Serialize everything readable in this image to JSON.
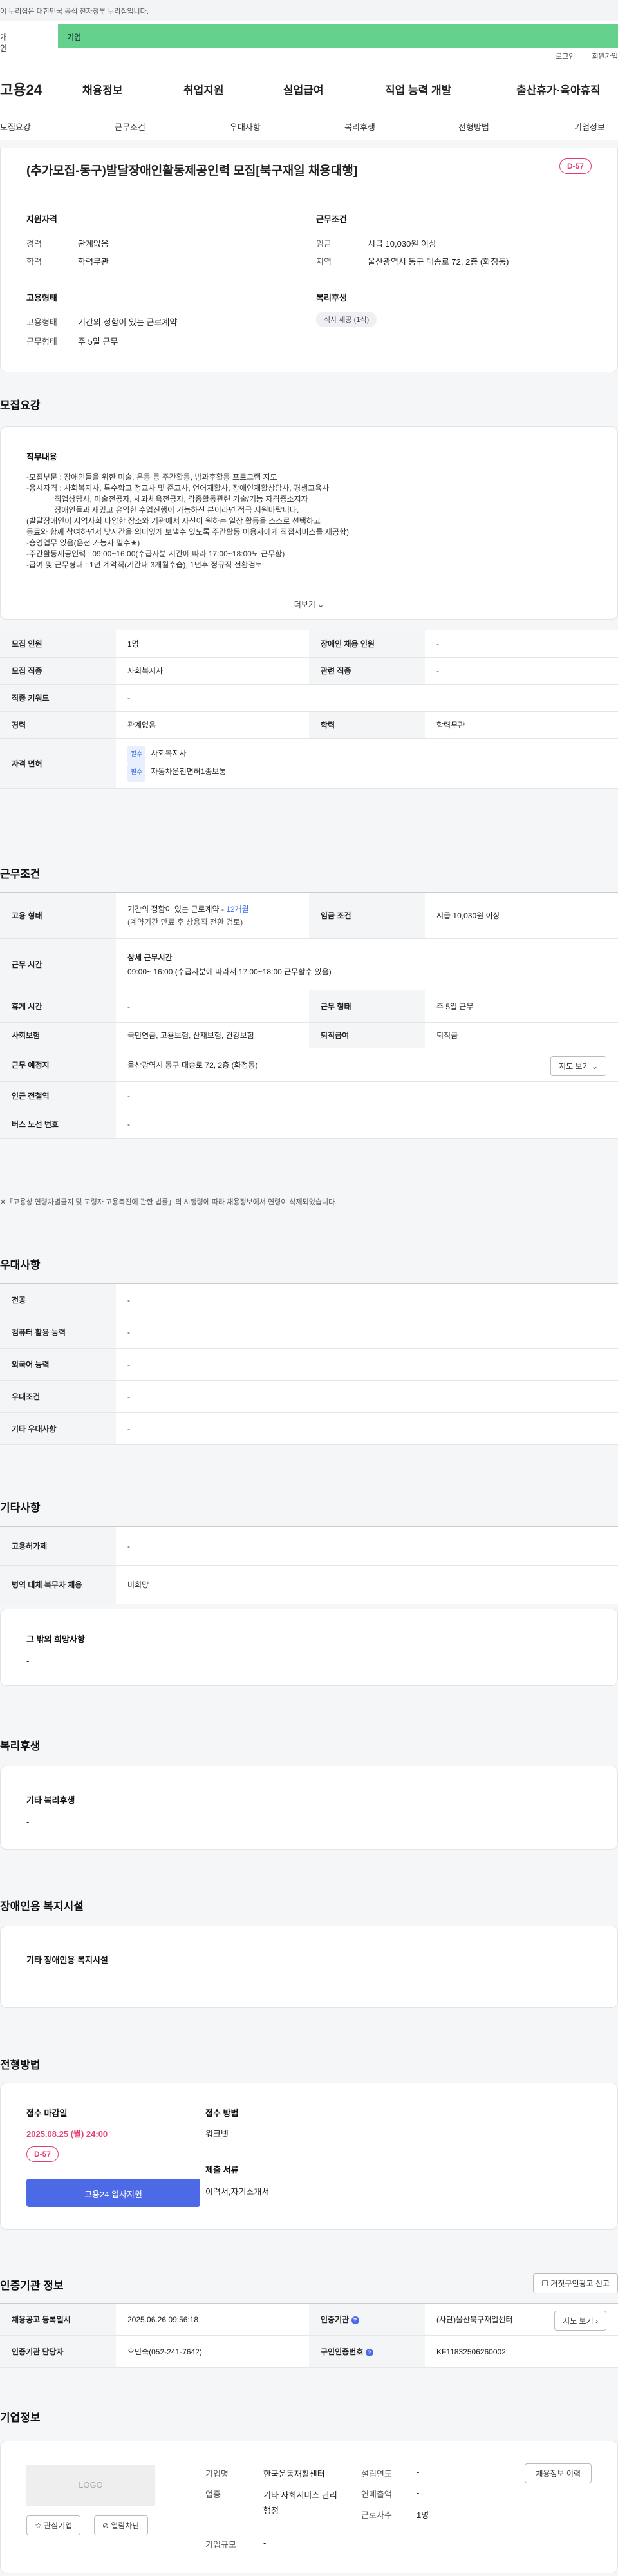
{
  "gov_banner": "이 누리집은 대한민국 공식 전자정부 누리집입니다.",
  "top_tabs": {
    "personal": "개인",
    "business": "기업"
  },
  "util": {
    "login": "로그인",
    "signup": "회원가입"
  },
  "logo": "고용24",
  "gnb": [
    "채용정보",
    "취업지원",
    "실업급여",
    "직업 능력 개발",
    "출산휴가·육아휴직"
  ],
  "subnav": [
    "모집요강",
    "근무조건",
    "우대사항",
    "복리후생",
    "전형방법",
    "기업정보"
  ],
  "header": {
    "title": "(추가모집-동구)발달장애인활동제공인력 모집[북구재일 채용대행]",
    "dday": "D-57",
    "qual_title": "지원자격",
    "career_label": "경력",
    "career": "관계없음",
    "edu_label": "학력",
    "edu": "학력무관",
    "cond_title": "근무조건",
    "wage_label": "임금",
    "wage": "시급 10,030원 이상",
    "region_label": "지역",
    "region": "울산광역시 동구 대송로 72, 2층 (화정동)",
    "emp_title": "고용형태",
    "emp_type_label": "고용형태",
    "emp_type": "기간의 정함이 있는 근로계약",
    "work_type_label": "근무형태",
    "work_type": "주 5일 근무",
    "welfare_title": "복리후생",
    "welfare_tag": "식사 제공 (1식)"
  },
  "recruit": {
    "title": "모집요강",
    "duty_title": "직무내용",
    "duty_lines": [
      "-모집부문 : 장애인들을 위한 미술, 운동 등 주간활동, 방과후활동 프로그램 지도",
      "-응시자격 : 사회복지사, 특수학교 정교사 및 준교사, 언어재활사, 장애인재활상담사, 평생교육사",
      "             직업상담사, 미술전공자, 체과체육전공자, 각종활동관련 기술/기능 자격증소지자",
      "             장애인들과 재밌고 유익한 수업진행이 가능하신 분이라면 적극 지원바랍니다.",
      "(발달장애인이 지역사회 다양한 장소와 기관에서 자신이 원하는 일상 활동을 스스로 선택하고",
      "동료와 함께 참여하면서 낮시간을 의미있게 보낼수 있도록 주간활동 이용자에게 직접서비스를 제공함)",
      "-승영업무 있음(운전 가능자 필수★)",
      "-주간활동제공인력 : 09:00~16:00(수급자분 시간에 따라 17:00~18:00도 근무함)",
      "-급여 및 근무형태 : 1년 계약직(기간내 3개월수습), 1년후 정규직 전환검토"
    ],
    "more": "더보기",
    "rows": [
      [
        "모집 인원",
        "1명",
        "장애인 채용 인원",
        "-"
      ],
      [
        "모집 직종",
        "사회복지사",
        "관련 직종",
        "-"
      ],
      [
        "직종 키워드",
        "-",
        "",
        ""
      ],
      [
        "경력",
        "관계없음",
        "학력",
        "학력무관"
      ]
    ],
    "license_label": "자격 면허",
    "must": "필수",
    "licenses": [
      "사회복지사",
      "자동차운전면허1종보통"
    ]
  },
  "work": {
    "title": "근무조건",
    "emp_label": "고용 형태",
    "emp_value": "기간의 정함이 있는 근로계약 - ",
    "emp_months": "12개월",
    "emp_sub": "(계약기간 만료 후 상용직 전환 검토)",
    "wage_label": "임금 조건",
    "wage": "시급 10,030원 이상",
    "time_label": "근무 시간",
    "time_title": "상세 근무시간",
    "time_value": "09:00~ 16:00 (수급자분에 따라서 17:00~18:00 근무할수 있음)",
    "rest_label": "휴게 시간",
    "rest": "-",
    "form_label": "근무 형태",
    "form": "주 5일 근무",
    "ins_label": "사회보험",
    "ins": "국민연금, 고용보험, 산재보험, 건강보험",
    "sev_label": "퇴직급여",
    "sev": "퇴직금",
    "place_label": "근무 예정지",
    "place": "울산광역시 동구 대송로 72, 2층 (화정동)",
    "map_btn": "지도 보기",
    "subway_label": "인근 전철역",
    "subway": "-",
    "bus_label": "버스 노선 번호",
    "bus": "-",
    "note": "※「고용상 연령차별금지 및 고령자 고용촉진에 관한 법률」의 시행령에 따라 채용정보에서 연령이 삭제되었습니다."
  },
  "prefer": {
    "title": "우대사항",
    "rows": [
      [
        "전공",
        "-"
      ],
      [
        "컴퓨터 활용 능력",
        "-"
      ],
      [
        "외국어 능력",
        "-"
      ],
      [
        "우대조건",
        "-"
      ],
      [
        "기타 우대사항",
        "-"
      ]
    ]
  },
  "etc": {
    "title": "기타사항",
    "rows": [
      [
        "고용허가제",
        "-"
      ],
      [
        "병역 대체 복무자 채용",
        "비희망"
      ]
    ],
    "hope_title": "그 밖의 희망사항",
    "hope": "-"
  },
  "welfare": {
    "title": "복리후생",
    "sub": "기타 복리후생",
    "value": "-"
  },
  "facility": {
    "title": "장애인용 복지시설",
    "sub": "기타 장애인용 복지시설",
    "value": "-"
  },
  "process": {
    "title": "전형방법",
    "deadline_title": "접수 마감일",
    "deadline": "2025.08.25 (월) 24:00",
    "dday": "D-57",
    "apply_btn": "고용24 입사지원",
    "method_title": "접수 방법",
    "method": "워크넷",
    "docs_title": "제출 서류",
    "docs": "이력서,자기소개서"
  },
  "agency": {
    "title": "인증기관 정보",
    "report_btn": "거짓구인광고 신고",
    "r1": [
      "채용공고 등록일시",
      "2025.06.26 09:56:18",
      "인증기관",
      "(사단)울산북구재일센터"
    ],
    "map_btn": "지도 보기",
    "r2": [
      "인증기관 담당자",
      "오민숙(052-241-7642)",
      "구인인증번호",
      "KF11832506260002"
    ]
  },
  "company": {
    "title": "기업정보",
    "logo": "LOGO",
    "fav_btn": "관심기업",
    "block_btn": "열람차단",
    "name_label": "기업명",
    "name": "한국운동재활센터",
    "industry_label": "업종",
    "industry": "기타 사회서비스 관리 행정",
    "scale_label": "기업규모",
    "scale": "-",
    "year_label": "설립연도",
    "year": "-",
    "revenue_label": "연매출액",
    "revenue": "-",
    "emp_label": "근로자수",
    "emp": "1명",
    "jobs_btn": "채용정보 이력"
  }
}
